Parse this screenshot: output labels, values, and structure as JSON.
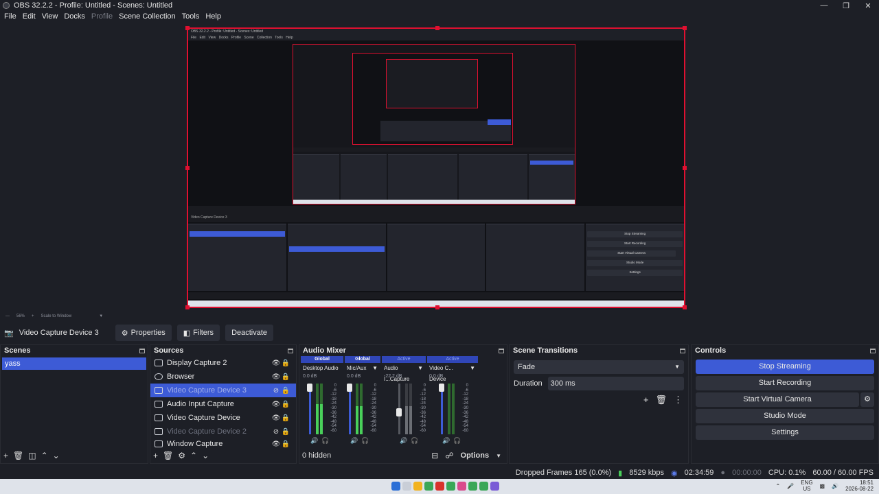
{
  "window": {
    "title": "OBS 32.2.2 - Profile: Untitled - Scenes: Untitled"
  },
  "menu": [
    "File",
    "Edit",
    "View",
    "Docks",
    "Profile",
    "Scene Collection",
    "Tools",
    "Help"
  ],
  "preview": {
    "zoom": "56%",
    "scale_mode": "Scale to Window"
  },
  "context": {
    "source_name": "Video Capture Device 3",
    "properties": "Properties",
    "filters": "Filters",
    "deactivate": "Deactivate"
  },
  "scenes": {
    "title": "Scenes",
    "items": [
      "yass"
    ]
  },
  "sources": {
    "title": "Sources",
    "items": [
      {
        "name": "Display Capture 2",
        "icon": "monitor-icon"
      },
      {
        "name": "Browser",
        "icon": "globe-icon"
      },
      {
        "name": "Video Capture Device 3",
        "icon": "camera-icon"
      },
      {
        "name": "Audio Input Capture",
        "icon": "microphone-icon"
      },
      {
        "name": "Video Capture Device",
        "icon": "camera-icon"
      },
      {
        "name": "Video Capture Device 2",
        "icon": "camera-icon"
      },
      {
        "name": "Window Capture",
        "icon": "window-icon"
      }
    ]
  },
  "mixer": {
    "title": "Audio Mixer",
    "channels": [
      {
        "header": "Global",
        "name": "Desktop Audio",
        "db": "0.0 dB",
        "level": 0.6
      },
      {
        "header": "Global",
        "name": "Mic/Aux",
        "db": "0.0 dB",
        "level": 0.55
      },
      {
        "header": "Active",
        "name": "Audio I...Capture",
        "db": "-22.2 dB",
        "level": 0.55
      },
      {
        "header": "Active",
        "name": "Video C... Device",
        "db": "0.0 dB",
        "level": 0.55
      }
    ],
    "ticks": [
      "0",
      "-6",
      "-12",
      "-18",
      "-24",
      "-30",
      "-36",
      "-42",
      "-48",
      "-54",
      "-60"
    ],
    "hidden": "0 hidden",
    "options": "Options"
  },
  "transitions": {
    "title": "Scene Transitions",
    "selected": "Fade",
    "duration_label": "Duration",
    "duration_value": "300 ms"
  },
  "controls": {
    "title": "Controls",
    "stop_streaming": "Stop Streaming",
    "start_recording": "Start Recording",
    "start_virtual_camera": "Start Virtual Camera",
    "studio_mode": "Studio Mode",
    "settings": "Settings"
  },
  "status": {
    "dropped_frames": "Dropped Frames 165 (0.0%)",
    "bitrate": "8529 kbps",
    "stream_time": "02:34:59",
    "rec_time": "00:00:00",
    "cpu": "CPU: 0.1%",
    "fps": "60.00 / 60.00 FPS"
  },
  "taskbar": {
    "lang1": "ENG",
    "lang2": "US",
    "time": "18:51",
    "date": "2026-08-22"
  },
  "colors": {
    "accent": "#3d5bd6",
    "selection_border": "#e01030",
    "meter_green": "#49d05a"
  }
}
